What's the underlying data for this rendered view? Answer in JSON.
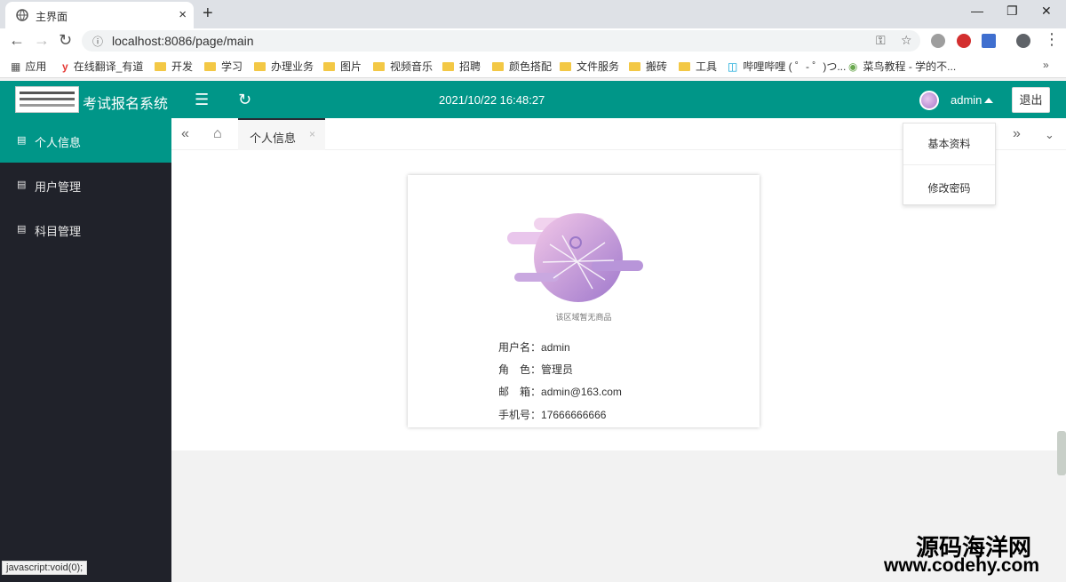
{
  "browser": {
    "tab_title": "主界面",
    "tab_close": "×",
    "new_tab": "+",
    "url": "localhost:8086/page/main",
    "bookmarks": [
      {
        "label": "应用",
        "type": "apps"
      },
      {
        "label": "在线翻译_有道",
        "type": "y"
      },
      {
        "label": "开发",
        "type": "folder"
      },
      {
        "label": "学习",
        "type": "folder"
      },
      {
        "label": "办理业务",
        "type": "folder"
      },
      {
        "label": "图片",
        "type": "folder"
      },
      {
        "label": "视频音乐",
        "type": "folder"
      },
      {
        "label": "招聘",
        "type": "folder"
      },
      {
        "label": "颜色搭配",
        "type": "folder"
      },
      {
        "label": "文件服务",
        "type": "folder"
      },
      {
        "label": "搬砖",
        "type": "folder"
      },
      {
        "label": "工具",
        "type": "folder"
      },
      {
        "label": "哔哩哔哩 ( ゜- ゜)つ...",
        "type": "bili"
      },
      {
        "label": "菜鸟教程 - 学的不...",
        "type": "runoob"
      }
    ],
    "status_text": "javascript:void(0);"
  },
  "header": {
    "title": "考试报名系统",
    "datetime": "2021/10/22 16:48:27",
    "username": "admin",
    "logout_label": "退出",
    "menu_icon": "menu-fold-icon",
    "refresh_icon": "refresh-icon",
    "accent": "#009688"
  },
  "sidebar": {
    "items": [
      {
        "label": "个人信息",
        "active": true
      },
      {
        "label": "用户管理",
        "active": false
      },
      {
        "label": "科目管理",
        "active": false
      }
    ]
  },
  "tabs": {
    "current": "个人信息",
    "close": "×"
  },
  "user_menu": {
    "items": [
      "基本资料",
      "修改密码"
    ]
  },
  "profile": {
    "empty_text": "该区域暂无商品",
    "rows": [
      {
        "label": "用户名：",
        "value": "admin"
      },
      {
        "label": "角　色：",
        "value": "管理员"
      },
      {
        "label": "邮　箱：",
        "value": "admin@163.com"
      },
      {
        "label": "手机号：",
        "value": "17666666666"
      }
    ]
  },
  "watermark": {
    "line1": "源码海洋网",
    "line2": "www.codehy.com"
  }
}
